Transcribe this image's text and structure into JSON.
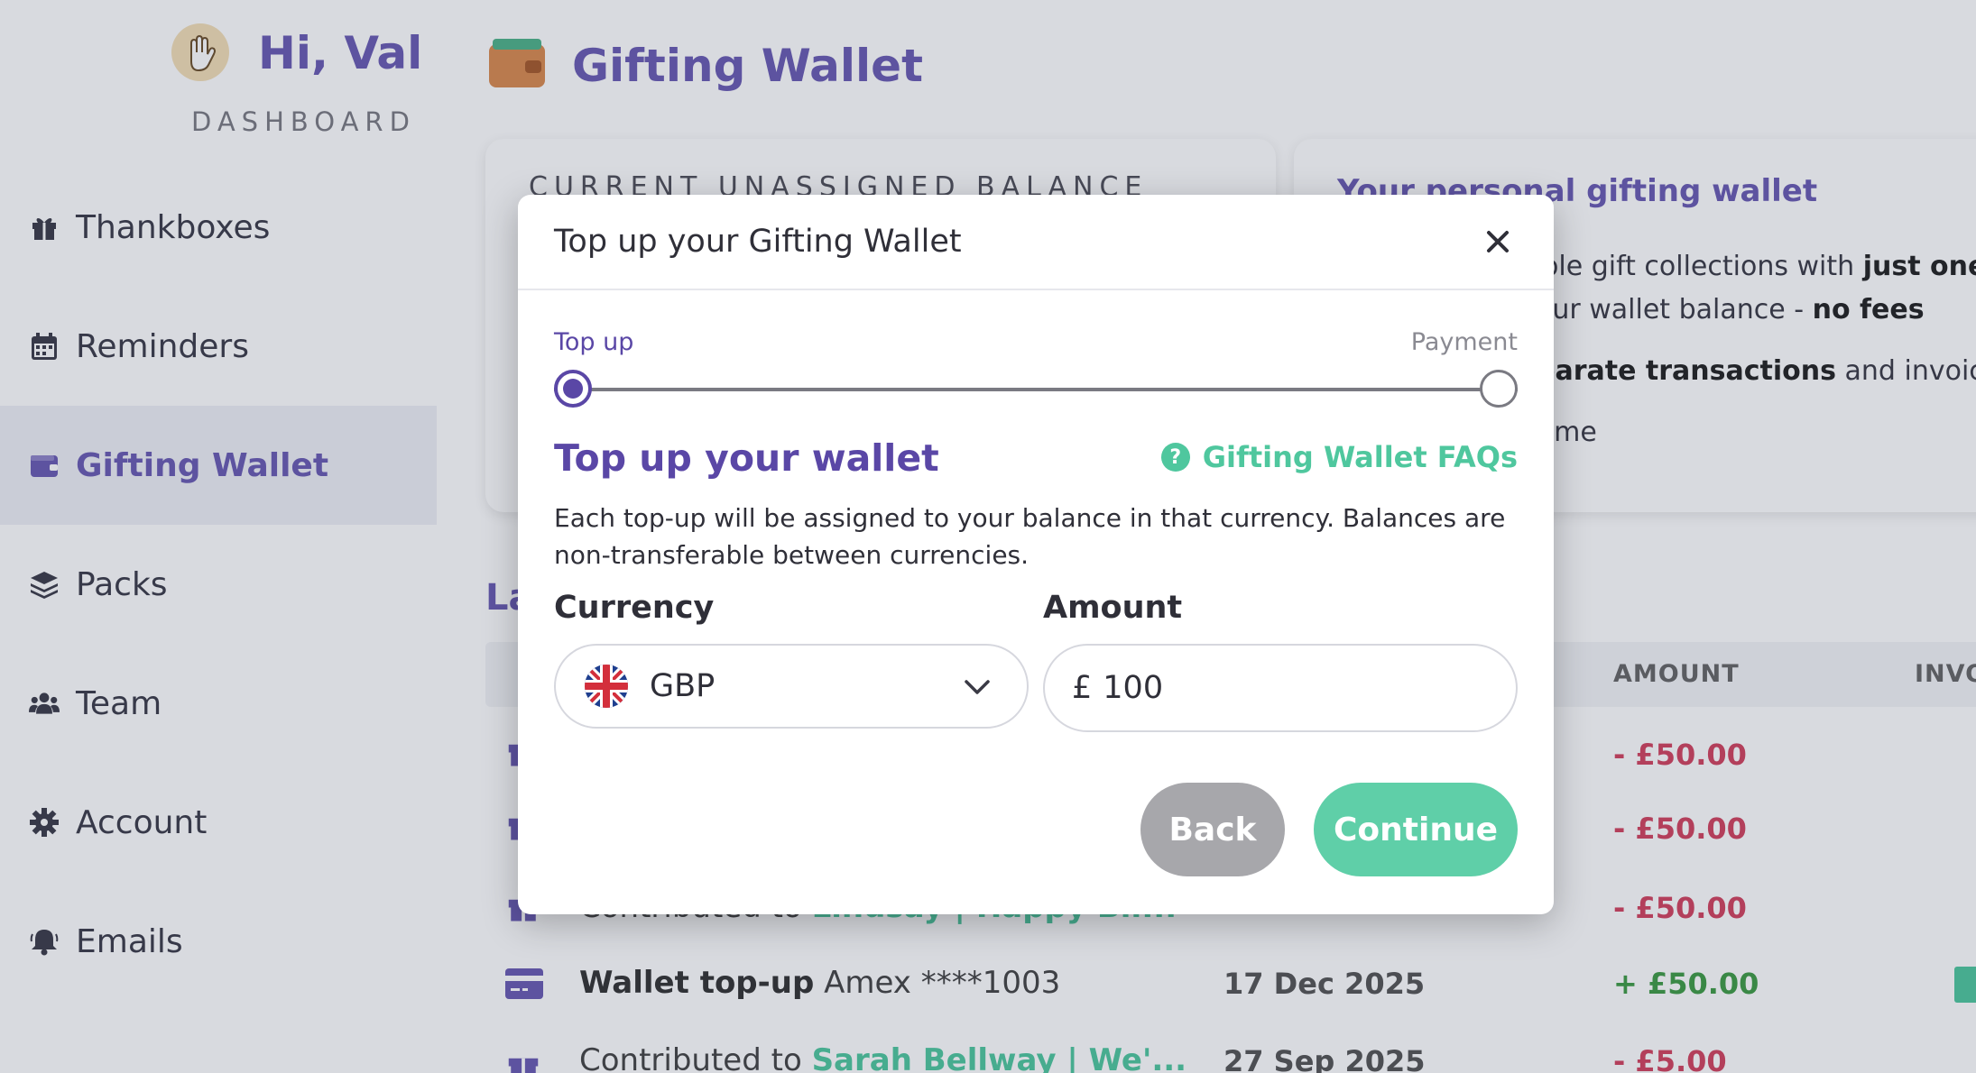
{
  "sidebar": {
    "greeting": "Hi,  Val",
    "subtitle": "DASHBOARD",
    "items": [
      {
        "label": "Thankboxes",
        "icon": "gift-icon"
      },
      {
        "label": "Reminders",
        "icon": "calendar-icon"
      },
      {
        "label": "Gifting Wallet",
        "icon": "wallet-icon",
        "active": true
      },
      {
        "label": "Packs",
        "icon": "layers-icon"
      },
      {
        "label": "Team",
        "icon": "users-icon"
      },
      {
        "label": "Account",
        "icon": "gear-icon"
      },
      {
        "label": "Emails",
        "icon": "bell-icon"
      }
    ]
  },
  "main": {
    "title": "Gifting Wallet",
    "balance_card": {
      "label": "CURRENT UNASSIGNED BALANCE"
    },
    "info_card": {
      "title": "Your personal gifting wallet",
      "line1_pre": "iple gift collections with ",
      "line1_bold": "just one",
      "line2_pre": "our wallet balance - ",
      "line2_bold": "no fees",
      "line3_bold": "parate transactions",
      "line3_post": " and invoices",
      "line4": "time"
    },
    "latest_title": "La",
    "table": {
      "headers": {
        "amount": "AMOUNT",
        "invoice": "INVO"
      },
      "rows": [
        {
          "amount": "- £50.00"
        },
        {
          "amount": "- £50.00"
        },
        {
          "desc_pre": "Contributed to ",
          "desc_link": "Lindsay | Happy Bir...",
          "amount": "- £50.00"
        },
        {
          "desc_bold": "Wallet top-up",
          "desc_rest": "Amex ****1003",
          "date": "17 Dec 2025",
          "amount": "+ £50.00"
        },
        {
          "desc_pre": "Contributed to ",
          "desc_link": "Sarah Bellway",
          "desc_link2": " | We'...",
          "date": "27 Sep 2025",
          "amount": "- £5.00"
        }
      ]
    }
  },
  "modal": {
    "title": "Top up your Gifting Wallet",
    "steps": {
      "step1": "Top up",
      "step2": "Payment"
    },
    "section_title": "Top up your wallet",
    "faq_link": "Gifting Wallet FAQs",
    "description": "Each top-up will be assigned to your balance in that currency. Balances are non-transferable between currencies.",
    "currency_label": "Currency",
    "currency_value": "GBP",
    "amount_label": "Amount",
    "amount_symbol": "£",
    "amount_value": "100",
    "back_label": "Back",
    "continue_label": "Continue"
  },
  "colors": {
    "brand_purple": "#6a5bb3",
    "accent_green": "#4fc79e",
    "negative": "#d2435e",
    "positive": "#3f9b45"
  }
}
